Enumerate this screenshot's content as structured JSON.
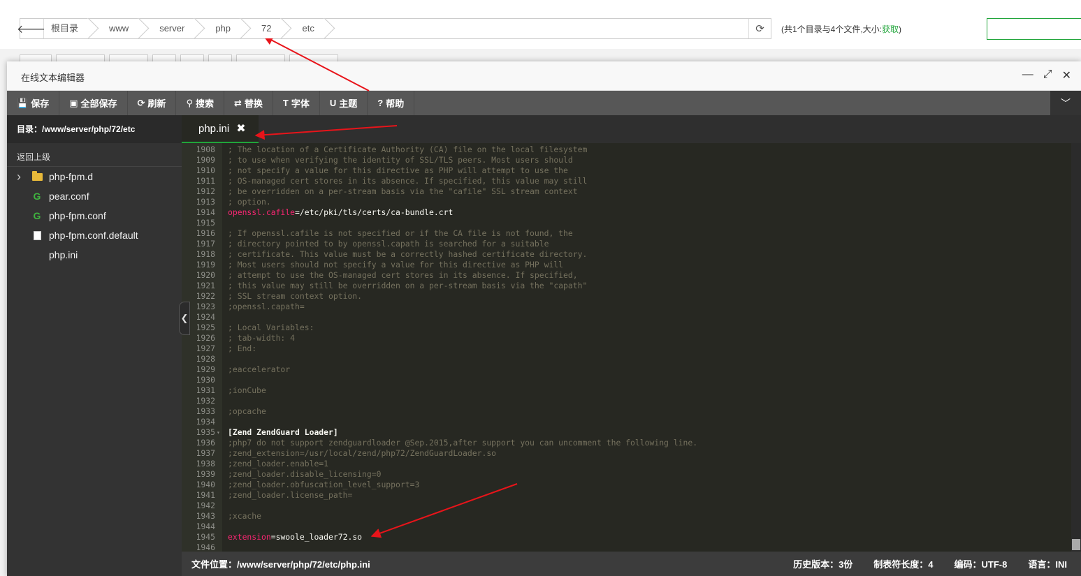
{
  "breadcrumb": {
    "items": [
      "根目录",
      "www",
      "server",
      "php",
      "72",
      "etc"
    ]
  },
  "summary": {
    "text": "(共1个目录与4个文件,大小:",
    "link": "获取",
    "close": ")"
  },
  "editor": {
    "title": "在线文本编辑器",
    "toolbar": [
      {
        "icon": "save-icon",
        "glyph": "💾",
        "label": "保存"
      },
      {
        "icon": "save-all-icon",
        "glyph": "▣",
        "label": "全部保存"
      },
      {
        "icon": "refresh-icon",
        "glyph": "⟳",
        "label": "刷新"
      },
      {
        "icon": "search-icon",
        "glyph": "⚲",
        "label": "搜索"
      },
      {
        "icon": "replace-icon",
        "glyph": "⇄",
        "label": "替换"
      },
      {
        "icon": "font-icon",
        "glyph": "T",
        "label": "字体"
      },
      {
        "icon": "theme-icon",
        "glyph": "U",
        "label": "主题"
      },
      {
        "icon": "help-icon",
        "glyph": "?",
        "label": "帮助"
      }
    ],
    "sidebar": {
      "dir_path": "目录：/www/server/php/72/etc",
      "go_up": "返回上级",
      "items": [
        {
          "type": "folder",
          "name": "php-fpm.d"
        },
        {
          "type": "g",
          "name": "pear.conf"
        },
        {
          "type": "g",
          "name": "php-fpm.conf"
        },
        {
          "type": "doc",
          "name": "php-fpm.conf.default"
        },
        {
          "type": "none",
          "name": "php.ini"
        }
      ]
    },
    "tab": {
      "label": "php.ini"
    },
    "lines": [
      {
        "n": "1908",
        "t": "; The location of a Certificate Authority (CA) file on the local filesystem",
        "k": "c"
      },
      {
        "n": "1909",
        "t": "; to use when verifying the identity of SSL/TLS peers. Most users should",
        "k": "c"
      },
      {
        "n": "1910",
        "t": "; not specify a value for this directive as PHP will attempt to use the",
        "k": "c"
      },
      {
        "n": "1911",
        "t": "; OS-managed cert stores in its absence. If specified, this value may still",
        "k": "c"
      },
      {
        "n": "1912",
        "t": "; be overridden on a per-stream basis via the \"cafile\" SSL stream context",
        "k": "c"
      },
      {
        "n": "1913",
        "t": "; option.",
        "k": "c"
      },
      {
        "n": "1914",
        "key": "openssl.cafile",
        "val": "=/etc/pki/tls/certs/ca-bundle.crt",
        "k": "kv"
      },
      {
        "n": "1915",
        "t": "",
        "k": "c"
      },
      {
        "n": "1916",
        "t": "; If openssl.cafile is not specified or if the CA file is not found, the",
        "k": "c"
      },
      {
        "n": "1917",
        "t": "; directory pointed to by openssl.capath is searched for a suitable",
        "k": "c"
      },
      {
        "n": "1918",
        "t": "; certificate. This value must be a correctly hashed certificate directory.",
        "k": "c"
      },
      {
        "n": "1919",
        "t": "; Most users should not specify a value for this directive as PHP will",
        "k": "c"
      },
      {
        "n": "1920",
        "t": "; attempt to use the OS-managed cert stores in its absence. If specified,",
        "k": "c"
      },
      {
        "n": "1921",
        "t": "; this value may still be overridden on a per-stream basis via the \"capath\"",
        "k": "c"
      },
      {
        "n": "1922",
        "t": "; SSL stream context option.",
        "k": "c"
      },
      {
        "n": "1923",
        "t": ";openssl.capath=",
        "k": "c"
      },
      {
        "n": "1924",
        "t": "",
        "k": "c"
      },
      {
        "n": "1925",
        "t": "; Local Variables:",
        "k": "c"
      },
      {
        "n": "1926",
        "t": "; tab-width: 4",
        "k": "c"
      },
      {
        "n": "1927",
        "t": "; End:",
        "k": "c"
      },
      {
        "n": "1928",
        "t": "",
        "k": "c"
      },
      {
        "n": "1929",
        "t": ";eaccelerator",
        "k": "c"
      },
      {
        "n": "1930",
        "t": "",
        "k": "c"
      },
      {
        "n": "1931",
        "t": ";ionCube",
        "k": "c"
      },
      {
        "n": "1932",
        "t": "",
        "k": "c"
      },
      {
        "n": "1933",
        "t": ";opcache",
        "k": "c"
      },
      {
        "n": "1934",
        "t": "",
        "k": "c"
      },
      {
        "n": "1935",
        "t": "[Zend ZendGuard Loader]",
        "k": "section",
        "fold": true
      },
      {
        "n": "1936",
        "t": ";php7 do not support zendguardloader @Sep.2015,after support you can uncomment the following line.",
        "k": "c"
      },
      {
        "n": "1937",
        "t": ";zend_extension=/usr/local/zend/php72/ZendGuardLoader.so",
        "k": "c"
      },
      {
        "n": "1938",
        "t": ";zend_loader.enable=1",
        "k": "c"
      },
      {
        "n": "1939",
        "t": ";zend_loader.disable_licensing=0",
        "k": "c"
      },
      {
        "n": "1940",
        "t": ";zend_loader.obfuscation_level_support=3",
        "k": "c"
      },
      {
        "n": "1941",
        "t": ";zend_loader.license_path=",
        "k": "c"
      },
      {
        "n": "1942",
        "t": "",
        "k": "c"
      },
      {
        "n": "1943",
        "t": ";xcache",
        "k": "c"
      },
      {
        "n": "1944",
        "t": "",
        "k": "c"
      },
      {
        "n": "1945",
        "key": "extension",
        "val": "=swoole_loader72.so",
        "k": "kv"
      },
      {
        "n": "1946",
        "t": "",
        "k": "c"
      }
    ],
    "status": {
      "file_path": "文件位置：/www/server/php/72/etc/php.ini",
      "history": "历史版本：3份",
      "tab_size": "制表符长度：4",
      "encoding": "编码：UTF-8",
      "language": "语言：INI"
    }
  },
  "colors": {
    "accent": "#20a53a",
    "annotation": "#e8141a"
  }
}
